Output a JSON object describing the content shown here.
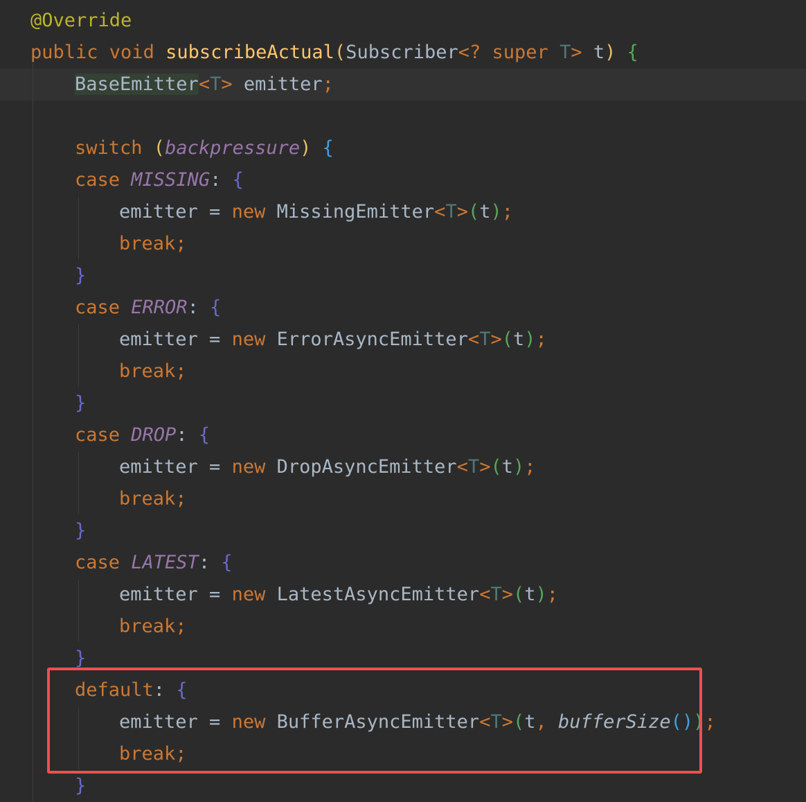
{
  "editor": {
    "lines": [
      {
        "indent": 0,
        "tokens": [
          {
            "t": "@Override",
            "c": "ann"
          }
        ]
      },
      {
        "indent": 0,
        "tokens": [
          {
            "t": "public ",
            "c": "kw"
          },
          {
            "t": "void ",
            "c": "kw"
          },
          {
            "t": "subscribeActual",
            "c": "fn"
          },
          {
            "t": "(",
            "c": "p1"
          },
          {
            "t": "Subscriber",
            "c": "cls"
          },
          {
            "t": "<? ",
            "c": "kw"
          },
          {
            "t": "super ",
            "c": "kw"
          },
          {
            "t": "T",
            "c": "tp"
          },
          {
            "t": "> ",
            "c": "kw"
          },
          {
            "t": "t",
            "c": "cls"
          },
          {
            "t": ") ",
            "c": "p1"
          },
          {
            "t": "{",
            "c": "p6"
          }
        ]
      },
      {
        "indent": 1,
        "current": true,
        "tokens": [
          {
            "t": "BaseEmitter",
            "c": "cls hl"
          },
          {
            "t": "<",
            "c": "kw"
          },
          {
            "t": "T",
            "c": "tp"
          },
          {
            "t": "> ",
            "c": "kw"
          },
          {
            "t": "emitter",
            "c": "cls"
          },
          {
            "t": ";",
            "c": "semi"
          }
        ]
      },
      {
        "indent": 0,
        "tokens": []
      },
      {
        "indent": 1,
        "tokens": [
          {
            "t": "switch ",
            "c": "kw"
          },
          {
            "t": "(",
            "c": "p1"
          },
          {
            "t": "backpressure",
            "c": "enum"
          },
          {
            "t": ") ",
            "c": "p1"
          },
          {
            "t": "{",
            "c": "p4"
          }
        ]
      },
      {
        "indent": 1,
        "tokens": [
          {
            "t": "case ",
            "c": "kw"
          },
          {
            "t": "MISSING",
            "c": "enum"
          },
          {
            "t": ": ",
            "c": "cls"
          },
          {
            "t": "{",
            "c": "p5"
          }
        ]
      },
      {
        "indent": 2,
        "tokens": [
          {
            "t": "emitter ",
            "c": "cls"
          },
          {
            "t": "= ",
            "c": "cls"
          },
          {
            "t": "new ",
            "c": "kw"
          },
          {
            "t": "MissingEmitter",
            "c": "cls"
          },
          {
            "t": "<",
            "c": "kw"
          },
          {
            "t": "T",
            "c": "tp"
          },
          {
            "t": ">",
            "c": "kw"
          },
          {
            "t": "(",
            "c": "p6"
          },
          {
            "t": "t",
            "c": "cls"
          },
          {
            "t": ")",
            "c": "p6"
          },
          {
            "t": ";",
            "c": "semi"
          }
        ]
      },
      {
        "indent": 2,
        "tokens": [
          {
            "t": "break",
            "c": "kw"
          },
          {
            "t": ";",
            "c": "semi"
          }
        ]
      },
      {
        "indent": 1,
        "tokens": [
          {
            "t": "}",
            "c": "p5"
          }
        ]
      },
      {
        "indent": 1,
        "tokens": [
          {
            "t": "case ",
            "c": "kw"
          },
          {
            "t": "ERROR",
            "c": "enum"
          },
          {
            "t": ": ",
            "c": "cls"
          },
          {
            "t": "{",
            "c": "p5"
          }
        ]
      },
      {
        "indent": 2,
        "tokens": [
          {
            "t": "emitter ",
            "c": "cls"
          },
          {
            "t": "= ",
            "c": "cls"
          },
          {
            "t": "new ",
            "c": "kw"
          },
          {
            "t": "ErrorAsyncEmitter",
            "c": "cls"
          },
          {
            "t": "<",
            "c": "kw"
          },
          {
            "t": "T",
            "c": "tp"
          },
          {
            "t": ">",
            "c": "kw"
          },
          {
            "t": "(",
            "c": "p6"
          },
          {
            "t": "t",
            "c": "cls"
          },
          {
            "t": ")",
            "c": "p6"
          },
          {
            "t": ";",
            "c": "semi"
          }
        ]
      },
      {
        "indent": 2,
        "tokens": [
          {
            "t": "break",
            "c": "kw"
          },
          {
            "t": ";",
            "c": "semi"
          }
        ]
      },
      {
        "indent": 1,
        "tokens": [
          {
            "t": "}",
            "c": "p5"
          }
        ]
      },
      {
        "indent": 1,
        "tokens": [
          {
            "t": "case ",
            "c": "kw"
          },
          {
            "t": "DROP",
            "c": "enum"
          },
          {
            "t": ": ",
            "c": "cls"
          },
          {
            "t": "{",
            "c": "p5"
          }
        ]
      },
      {
        "indent": 2,
        "tokens": [
          {
            "t": "emitter ",
            "c": "cls"
          },
          {
            "t": "= ",
            "c": "cls"
          },
          {
            "t": "new ",
            "c": "kw"
          },
          {
            "t": "DropAsyncEmitter",
            "c": "cls"
          },
          {
            "t": "<",
            "c": "kw"
          },
          {
            "t": "T",
            "c": "tp"
          },
          {
            "t": ">",
            "c": "kw"
          },
          {
            "t": "(",
            "c": "p6"
          },
          {
            "t": "t",
            "c": "cls"
          },
          {
            "t": ")",
            "c": "p6"
          },
          {
            "t": ";",
            "c": "semi"
          }
        ]
      },
      {
        "indent": 2,
        "tokens": [
          {
            "t": "break",
            "c": "kw"
          },
          {
            "t": ";",
            "c": "semi"
          }
        ]
      },
      {
        "indent": 1,
        "tokens": [
          {
            "t": "}",
            "c": "p5"
          }
        ]
      },
      {
        "indent": 1,
        "tokens": [
          {
            "t": "case ",
            "c": "kw"
          },
          {
            "t": "LATEST",
            "c": "enum"
          },
          {
            "t": ": ",
            "c": "cls"
          },
          {
            "t": "{",
            "c": "p5"
          }
        ]
      },
      {
        "indent": 2,
        "tokens": [
          {
            "t": "emitter ",
            "c": "cls"
          },
          {
            "t": "= ",
            "c": "cls"
          },
          {
            "t": "new ",
            "c": "kw"
          },
          {
            "t": "LatestAsyncEmitter",
            "c": "cls"
          },
          {
            "t": "<",
            "c": "kw"
          },
          {
            "t": "T",
            "c": "tp"
          },
          {
            "t": ">",
            "c": "kw"
          },
          {
            "t": "(",
            "c": "p6"
          },
          {
            "t": "t",
            "c": "cls"
          },
          {
            "t": ")",
            "c": "p6"
          },
          {
            "t": ";",
            "c": "semi"
          }
        ]
      },
      {
        "indent": 2,
        "tokens": [
          {
            "t": "break",
            "c": "kw"
          },
          {
            "t": ";",
            "c": "semi"
          }
        ]
      },
      {
        "indent": 1,
        "tokens": [
          {
            "t": "}",
            "c": "p5"
          }
        ]
      },
      {
        "indent": 1,
        "tokens": [
          {
            "t": "default",
            "c": "kw"
          },
          {
            "t": ": ",
            "c": "cls"
          },
          {
            "t": "{",
            "c": "p5"
          }
        ]
      },
      {
        "indent": 2,
        "tokens": [
          {
            "t": "emitter ",
            "c": "cls"
          },
          {
            "t": "= ",
            "c": "cls"
          },
          {
            "t": "new ",
            "c": "kw"
          },
          {
            "t": "BufferAsyncEmitter",
            "c": "cls"
          },
          {
            "t": "<",
            "c": "kw"
          },
          {
            "t": "T",
            "c": "tp"
          },
          {
            "t": ">",
            "c": "kw"
          },
          {
            "t": "(",
            "c": "p6"
          },
          {
            "t": "t",
            "c": "cls"
          },
          {
            "t": ", ",
            "c": "semi"
          },
          {
            "t": "bufferSize",
            "c": "cls ital"
          },
          {
            "t": "()",
            "c": "p4"
          },
          {
            "t": ")",
            "c": "p6"
          },
          {
            "t": ";",
            "c": "semi"
          }
        ]
      },
      {
        "indent": 2,
        "tokens": [
          {
            "t": "break",
            "c": "kw"
          },
          {
            "t": ";",
            "c": "semi"
          }
        ]
      },
      {
        "indent": 1,
        "tokens": [
          {
            "t": "}",
            "c": "p5"
          }
        ]
      }
    ]
  }
}
